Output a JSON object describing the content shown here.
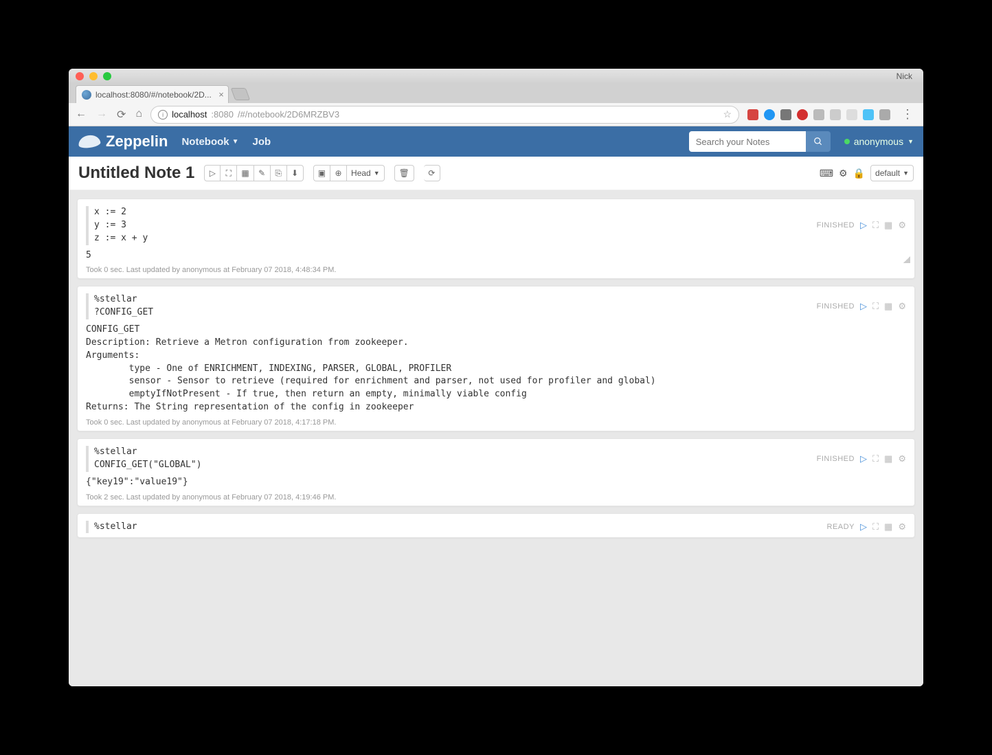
{
  "browser": {
    "os_user": "Nick",
    "tab_title": "localhost:8080/#/notebook/2D...",
    "url_host": "localhost",
    "url_port": ":8080",
    "url_path": "/#/notebook/2D6MRZBV3"
  },
  "navbar": {
    "brand": "Zeppelin",
    "menu_notebook": "Notebook",
    "menu_job": "Job",
    "search_placeholder": "Search your Notes",
    "user": "anonymous"
  },
  "note": {
    "title": "Untitled Note 1",
    "version_label": "Head",
    "mode_label": "default"
  },
  "paragraphs": {
    "p1": {
      "status": "FINISHED",
      "code": "x := 2\ny := 3\nz := x + y",
      "output": "5",
      "meta": "Took 0 sec. Last updated by anonymous at February 07 2018, 4:48:34 PM."
    },
    "p2": {
      "status": "FINISHED",
      "code": "%stellar\n?CONFIG_GET",
      "output": "CONFIG_GET\nDescription: Retrieve a Metron configuration from zookeeper.\nArguments:\n        type - One of ENRICHMENT, INDEXING, PARSER, GLOBAL, PROFILER\n        sensor - Sensor to retrieve (required for enrichment and parser, not used for profiler and global)\n        emptyIfNotPresent - If true, then return an empty, minimally viable config\nReturns: The String representation of the config in zookeeper",
      "meta": "Took 0 sec. Last updated by anonymous at February 07 2018, 4:17:18 PM."
    },
    "p3": {
      "status": "FINISHED",
      "code": "%stellar\nCONFIG_GET(\"GLOBAL\")",
      "output": "{\"key19\":\"value19\"}",
      "meta": "Took 2 sec. Last updated by anonymous at February 07 2018, 4:19:46 PM."
    },
    "p4": {
      "status": "READY",
      "code": "%stellar"
    }
  }
}
